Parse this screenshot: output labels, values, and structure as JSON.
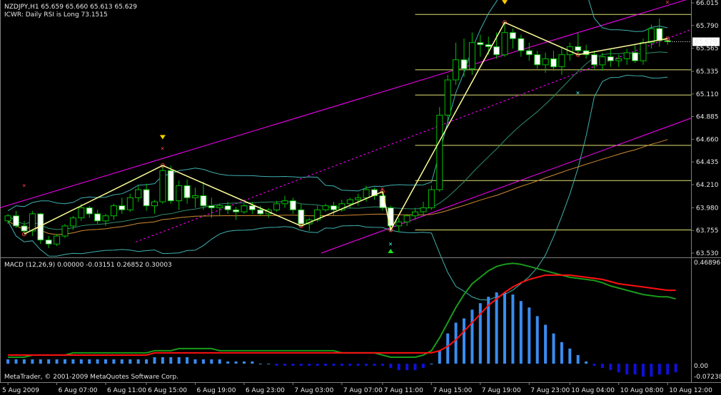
{
  "header": {
    "symbol_line": "NZDJPY,H1  65.659 65.660 65.613 65.629",
    "indicator_line": "ICWR: Daily RSI is Long 73.1515"
  },
  "macd": {
    "label": "MACD  (12,26,9) 0.00000 -0.03151 0.26852 0.30003",
    "y_ticks": [
      "0.46896",
      "0.00",
      "-0.07238"
    ]
  },
  "copyright": "MetaTrader, © 2001-2009 MetaQuotes Software Corp.",
  "colors": {
    "background": "#000000",
    "grid": "#7f7f7f",
    "bull_candle": "#000000",
    "bear_candle": "#ffffff",
    "wick": "#00c000",
    "zigzag": "#ffff99",
    "channel": "#ff00ff",
    "bollinger": "#40b0b0",
    "fibo": "#e0e070",
    "macd_main": "#1a9a1a",
    "macd_signal": "#ff1010",
    "macd_hist_pos": "#3a8cf0",
    "macd_hist_neg": "#1010d8"
  },
  "chart_data": [
    {
      "type": "candlestick",
      "symbol": "NZDJPY",
      "timeframe": "H1",
      "y_ticks": [
        "66.015",
        "65.790",
        "65.565",
        "65.335",
        "65.110",
        "64.885",
        "64.660",
        "64.435",
        "64.210",
        "63.980",
        "63.755",
        "63.530"
      ],
      "ylim": [
        63.53,
        66.015
      ],
      "current_price": "65.629",
      "x_ticks": [
        "5 Aug 2009",
        "6 Aug 07:00",
        "6 Aug 11:00",
        "6 Aug 15:00",
        "6 Aug 19:00",
        "6 Aug 23:00",
        "7 Aug 03:00",
        "7 Aug 07:00",
        "7 Aug 11:00",
        "7 Aug 15:00",
        "7 Aug 19:00",
        "7 Aug 23:00",
        "10 Aug 04:00",
        "10 Aug 08:00",
        "10 Aug 12:00"
      ],
      "candles": [
        [
          63.85,
          63.92,
          63.82,
          63.9
        ],
        [
          63.9,
          63.95,
          63.78,
          63.8
        ],
        [
          63.8,
          63.85,
          63.72,
          63.75
        ],
        [
          63.75,
          63.95,
          63.7,
          63.92
        ],
        [
          63.92,
          63.93,
          63.62,
          63.66
        ],
        [
          63.66,
          63.7,
          63.58,
          63.62
        ],
        [
          63.62,
          63.72,
          63.6,
          63.7
        ],
        [
          63.7,
          63.82,
          63.68,
          63.8
        ],
        [
          63.8,
          63.9,
          63.76,
          63.88
        ],
        [
          63.88,
          64.02,
          63.85,
          63.98
        ],
        [
          63.98,
          64.0,
          63.88,
          63.92
        ],
        [
          63.92,
          63.96,
          63.82,
          63.85
        ],
        [
          63.85,
          63.92,
          63.8,
          63.9
        ],
        [
          63.9,
          64.02,
          63.86,
          64.0
        ],
        [
          64.0,
          64.08,
          63.92,
          63.96
        ],
        [
          63.96,
          64.12,
          63.94,
          64.08
        ],
        [
          64.08,
          64.2,
          64.04,
          64.16
        ],
        [
          64.16,
          64.22,
          63.95,
          64.0
        ],
        [
          64.0,
          64.06,
          63.92,
          64.04
        ],
        [
          64.04,
          64.4,
          64.02,
          64.35
        ],
        [
          64.35,
          64.4,
          64.02,
          64.05
        ],
        [
          64.05,
          64.25,
          63.96,
          64.2
        ],
        [
          64.2,
          64.26,
          64.02,
          64.08
        ],
        [
          64.08,
          64.18,
          63.98,
          64.1
        ],
        [
          64.1,
          64.24,
          63.96,
          64.0
        ],
        [
          64.0,
          64.08,
          63.88,
          63.98
        ],
        [
          63.98,
          64.02,
          63.9,
          64.0
        ],
        [
          64.0,
          64.04,
          63.92,
          63.96
        ],
        [
          63.96,
          63.99,
          63.86,
          63.94
        ],
        [
          63.94,
          64.02,
          63.92,
          64.0
        ],
        [
          64.0,
          64.04,
          63.92,
          63.96
        ],
        [
          63.96,
          64.0,
          63.9,
          63.92
        ],
        [
          63.92,
          63.98,
          63.88,
          63.96
        ],
        [
          63.96,
          64.05,
          63.94,
          64.02
        ],
        [
          64.02,
          64.1,
          63.98,
          64.05
        ],
        [
          64.05,
          64.08,
          63.92,
          63.96
        ],
        [
          63.96,
          64.02,
          63.8,
          63.82
        ],
        [
          63.82,
          63.88,
          63.75,
          63.86
        ],
        [
          63.86,
          64.0,
          63.84,
          63.96
        ],
        [
          63.96,
          64.02,
          63.94,
          64.0
        ],
        [
          64.0,
          64.04,
          63.9,
          63.96
        ],
        [
          63.96,
          64.06,
          63.94,
          64.02
        ],
        [
          64.02,
          64.08,
          63.98,
          64.06
        ],
        [
          64.06,
          64.12,
          64.0,
          64.08
        ],
        [
          64.08,
          64.2,
          64.04,
          64.16
        ],
        [
          64.16,
          64.18,
          64.06,
          64.1
        ],
        [
          64.1,
          64.14,
          63.95,
          63.98
        ],
        [
          63.98,
          64.0,
          63.76,
          63.8
        ],
        [
          63.8,
          63.88,
          63.74,
          63.84
        ],
        [
          63.84,
          63.92,
          63.8,
          63.9
        ],
        [
          63.9,
          63.98,
          63.86,
          63.94
        ],
        [
          63.94,
          64.04,
          63.9,
          63.98
        ],
        [
          63.98,
          64.2,
          63.96,
          64.16
        ],
        [
          64.16,
          64.98,
          64.14,
          64.9
        ],
        [
          64.9,
          65.3,
          64.84,
          65.25
        ],
        [
          65.25,
          65.62,
          65.2,
          65.45
        ],
        [
          65.45,
          65.66,
          65.28,
          65.36
        ],
        [
          65.36,
          65.72,
          65.3,
          65.62
        ],
        [
          65.62,
          65.7,
          65.48,
          65.6
        ],
        [
          65.6,
          65.68,
          65.5,
          65.58
        ],
        [
          65.58,
          65.72,
          65.46,
          65.5
        ],
        [
          65.5,
          65.82,
          65.48,
          65.72
        ],
        [
          65.72,
          65.76,
          65.56,
          65.66
        ],
        [
          65.66,
          65.7,
          65.48,
          65.54
        ],
        [
          65.54,
          65.62,
          65.44,
          65.5
        ],
        [
          65.5,
          65.54,
          65.36,
          65.4
        ],
        [
          65.4,
          65.52,
          65.32,
          65.46
        ],
        [
          65.46,
          65.54,
          65.34,
          65.38
        ],
        [
          65.38,
          65.58,
          65.3,
          65.5
        ],
        [
          65.5,
          65.62,
          65.44,
          65.58
        ],
        [
          65.58,
          65.72,
          65.5,
          65.54
        ],
        [
          65.54,
          65.6,
          65.46,
          65.5
        ],
        [
          65.5,
          65.54,
          65.36,
          65.4
        ],
        [
          65.4,
          65.52,
          65.34,
          65.48
        ],
        [
          65.48,
          65.56,
          65.38,
          65.44
        ],
        [
          65.44,
          65.5,
          65.38,
          65.46
        ],
        [
          65.46,
          65.56,
          65.4,
          65.52
        ],
        [
          65.52,
          65.6,
          65.42,
          65.44
        ],
        [
          65.44,
          65.66,
          65.4,
          65.62
        ],
        [
          65.62,
          65.8,
          65.56,
          65.76
        ],
        [
          65.76,
          65.86,
          65.58,
          65.64
        ],
        [
          65.64,
          65.66,
          65.6,
          65.63
        ]
      ],
      "markers": {
        "sell_arrows": [
          "6 Aug 15:00",
          "7 Aug 19:00"
        ],
        "buy_arrows": [
          "7 Aug 11:00"
        ]
      }
    },
    {
      "type": "macd",
      "params": "(12,26,9)",
      "ylim": [
        -0.07238,
        0.46896
      ],
      "histogram": [
        0.02,
        0.02,
        0.02,
        0.02,
        0.02,
        0.02,
        0.02,
        0.02,
        0.02,
        0.02,
        0.02,
        0.02,
        0.02,
        0.02,
        0.02,
        0.02,
        0.02,
        0.02,
        0.03,
        0.03,
        0.03,
        0.03,
        0.03,
        0.02,
        0.02,
        0.02,
        0.02,
        0.01,
        0.01,
        0.01,
        0.01,
        0.0,
        0.0,
        -0.01,
        -0.01,
        -0.01,
        -0.01,
        -0.01,
        -0.01,
        -0.01,
        -0.01,
        -0.01,
        -0.01,
        -0.01,
        -0.01,
        -0.01,
        -0.01,
        -0.02,
        -0.03,
        -0.03,
        -0.03,
        -0.02,
        0.0,
        0.06,
        0.14,
        0.19,
        0.21,
        0.25,
        0.28,
        0.31,
        0.33,
        0.33,
        0.32,
        0.29,
        0.26,
        0.22,
        0.18,
        0.14,
        0.1,
        0.07,
        0.04,
        0.01,
        -0.01,
        -0.02,
        -0.03,
        -0.04,
        -0.05,
        -0.05,
        -0.06,
        -0.06,
        -0.05,
        -0.05,
        -0.04
      ],
      "main": [
        0.03,
        0.03,
        0.03,
        0.04,
        0.04,
        0.04,
        0.04,
        0.04,
        0.05,
        0.05,
        0.05,
        0.05,
        0.05,
        0.05,
        0.05,
        0.05,
        0.05,
        0.05,
        0.06,
        0.06,
        0.06,
        0.07,
        0.07,
        0.07,
        0.07,
        0.07,
        0.06,
        0.06,
        0.06,
        0.06,
        0.06,
        0.06,
        0.06,
        0.06,
        0.06,
        0.06,
        0.06,
        0.06,
        0.06,
        0.06,
        0.06,
        0.05,
        0.05,
        0.05,
        0.05,
        0.05,
        0.04,
        0.03,
        0.03,
        0.03,
        0.03,
        0.04,
        0.06,
        0.12,
        0.19,
        0.26,
        0.32,
        0.37,
        0.4,
        0.43,
        0.45,
        0.46,
        0.465,
        0.46,
        0.45,
        0.44,
        0.43,
        0.42,
        0.41,
        0.4,
        0.395,
        0.39,
        0.385,
        0.375,
        0.36,
        0.35,
        0.34,
        0.33,
        0.32,
        0.315,
        0.31,
        0.31,
        0.3
      ],
      "signal": [
        0.04,
        0.04,
        0.04,
        0.04,
        0.04,
        0.04,
        0.04,
        0.04,
        0.04,
        0.04,
        0.04,
        0.04,
        0.04,
        0.04,
        0.04,
        0.04,
        0.04,
        0.04,
        0.05,
        0.05,
        0.05,
        0.05,
        0.05,
        0.05,
        0.05,
        0.05,
        0.05,
        0.05,
        0.05,
        0.05,
        0.05,
        0.05,
        0.05,
        0.05,
        0.05,
        0.05,
        0.05,
        0.05,
        0.05,
        0.05,
        0.05,
        0.05,
        0.05,
        0.05,
        0.05,
        0.05,
        0.05,
        0.05,
        0.05,
        0.05,
        0.05,
        0.05,
        0.05,
        0.06,
        0.08,
        0.11,
        0.15,
        0.19,
        0.23,
        0.27,
        0.3,
        0.33,
        0.355,
        0.375,
        0.39,
        0.4,
        0.41,
        0.41,
        0.41,
        0.41,
        0.405,
        0.4,
        0.395,
        0.39,
        0.38,
        0.37,
        0.365,
        0.36,
        0.355,
        0.35,
        0.345,
        0.34,
        0.34
      ]
    }
  ]
}
